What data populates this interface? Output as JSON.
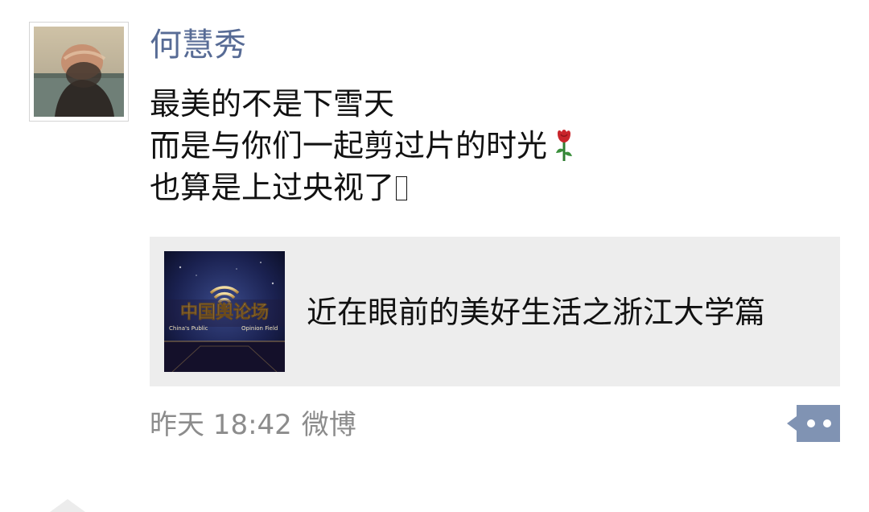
{
  "post": {
    "username": "何慧秀",
    "lines": [
      "最美的不是下雪天",
      "而是与你们一起剪过片的时光",
      "也算是上过央视了"
    ],
    "line2_emoji": "rose-emoji",
    "line3_emoji": "missing-glyph-emoji",
    "share": {
      "title": "近在眼前的美好生活之浙江大学篇",
      "thumb_title": "中国舆论场",
      "thumb_subtitle_left": "China's Public",
      "thumb_subtitle_right": "Opinion Field"
    },
    "time": "昨天 18:42",
    "source": "微博",
    "comment_icon": "comment-dots-icon"
  },
  "colors": {
    "username": "#576b95",
    "meta": "#8c8c8c",
    "card_bg": "#ededed",
    "comment_btn": "#8093b3"
  }
}
